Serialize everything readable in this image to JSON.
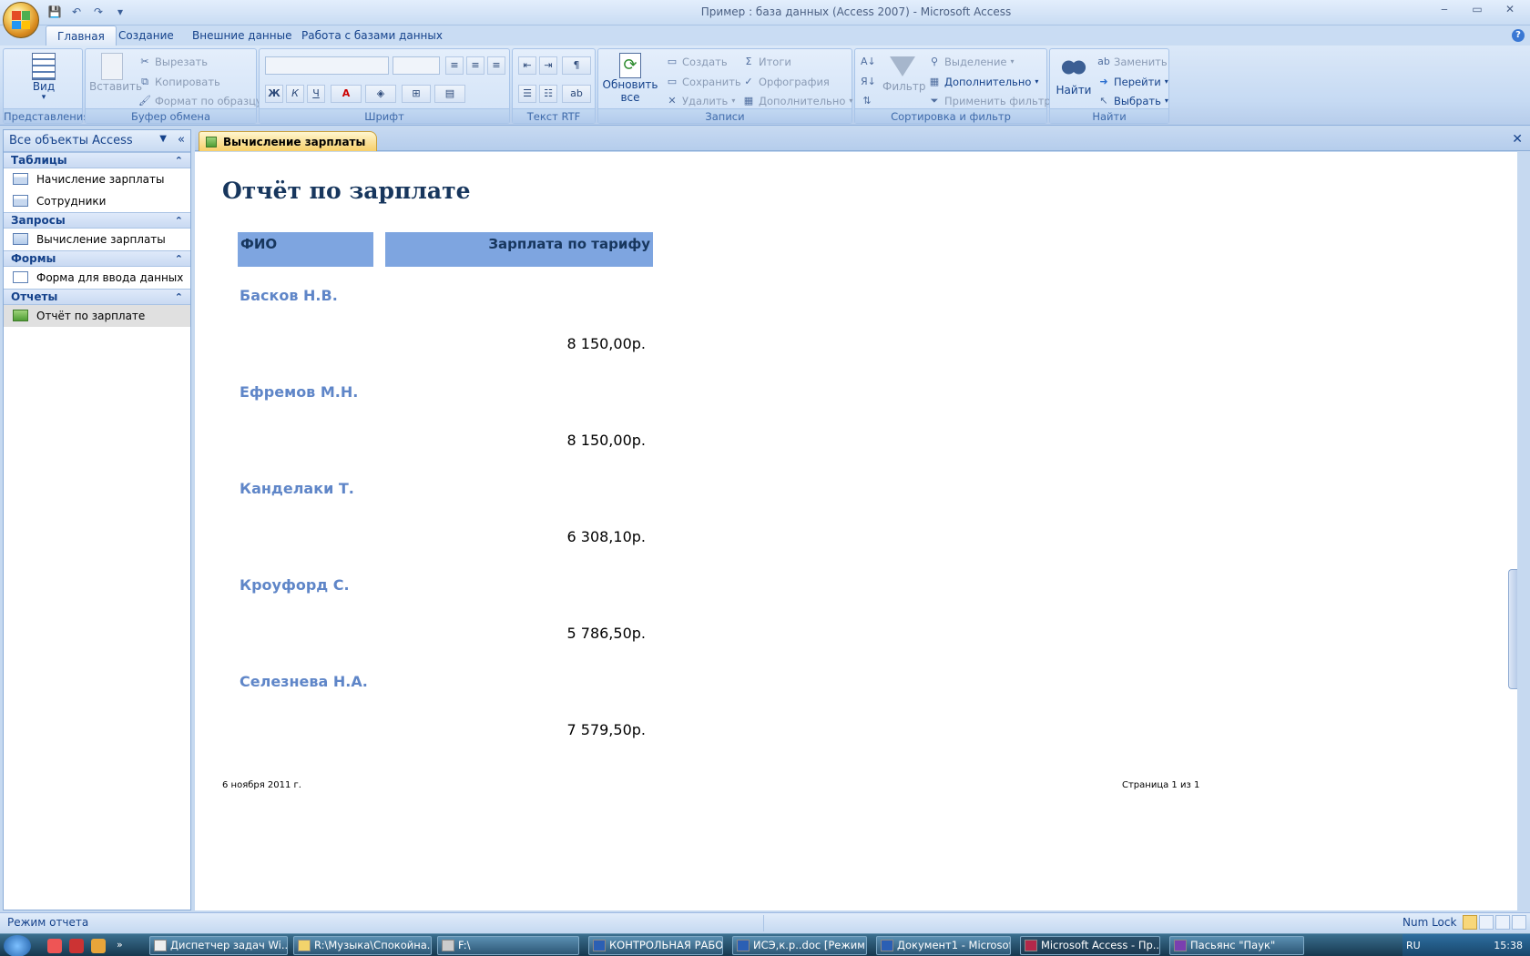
{
  "window": {
    "title": "Пример : база данных (Access 2007) - Microsoft Access",
    "controls": [
      "‒",
      "▭",
      "✕"
    ]
  },
  "ribbon": {
    "tabs": [
      "Главная",
      "Создание",
      "Внешние данные",
      "Работа с базами данных"
    ],
    "active_tab": "Главная",
    "groups": {
      "views": {
        "label": "Представления",
        "view": "Вид"
      },
      "clipboard": {
        "label": "Буфер обмена",
        "paste": "Вставить",
        "cut": "Вырезать",
        "copy": "Копировать",
        "format_painter": "Формат по образцу"
      },
      "font": {
        "label": "Шрифт",
        "bold": "Ж",
        "italic": "К",
        "underline": "Ч",
        "font_color": "A"
      },
      "rtf": {
        "label": "Текст RTF"
      },
      "records": {
        "label": "Записи",
        "refresh": "Обновить все",
        "new": "Создать",
        "save": "Сохранить",
        "delete": "Удалить",
        "totals": "Итоги",
        "spelling": "Орфография",
        "more": "Дополнительно"
      },
      "sort_filter": {
        "label": "Сортировка и фильтр",
        "filter": "Фильтр",
        "selection": "Выделение",
        "advanced": "Дополнительно",
        "toggle": "Применить фильтр"
      },
      "find": {
        "label": "Найти",
        "find": "Найти",
        "replace": "Заменить",
        "goto": "Перейти",
        "select": "Выбрать"
      }
    }
  },
  "nav_pane": {
    "header": "Все объекты Access",
    "groups": [
      {
        "label": "Таблицы",
        "items": [
          "Начисление зарплаты",
          "Сотрудники"
        ]
      },
      {
        "label": "Запросы",
        "items": [
          "Вычисление зарплаты"
        ]
      },
      {
        "label": "Формы",
        "items": [
          "Форма для ввода данных"
        ]
      },
      {
        "label": "Отчеты",
        "items": [
          "Отчёт по зарплате"
        ]
      }
    ]
  },
  "document_tab": {
    "label": "Вычисление зарплаты"
  },
  "report": {
    "title": "Отчёт по зарплате",
    "columns": {
      "name": "ФИО",
      "salary": "Зарплата по тарифу"
    },
    "rows": [
      {
        "name": "Басков Н.В.",
        "salary": "8 150,00р."
      },
      {
        "name": "Ефремов М.Н.",
        "salary": "8 150,00р."
      },
      {
        "name": "Канделаки Т.",
        "salary": "6 308,10р."
      },
      {
        "name": "Кроуфорд С.",
        "salary": "5 786,50р."
      },
      {
        "name": "Селезнева Н.А.",
        "salary": "7 579,50р."
      }
    ],
    "footer_date": "6 ноября 2011 г.",
    "footer_page": "Страница 1 из 1"
  },
  "status_bar": {
    "mode": "Режим отчета",
    "num_lock": "Num Lock"
  },
  "taskbar": {
    "buttons": [
      "Диспетчер задач Wi...",
      "R:\\Музыка\\Спокойна...",
      "F:\\",
      "КОНТРОЛЬНАЯ РАБО...",
      "ИСЭ,к.р..doc [Режим ...",
      "Документ1 - Microsof...",
      "Microsoft Access - Пр...",
      "Пасьянс \"Паук\""
    ],
    "language": "RU",
    "clock": "15:38"
  }
}
